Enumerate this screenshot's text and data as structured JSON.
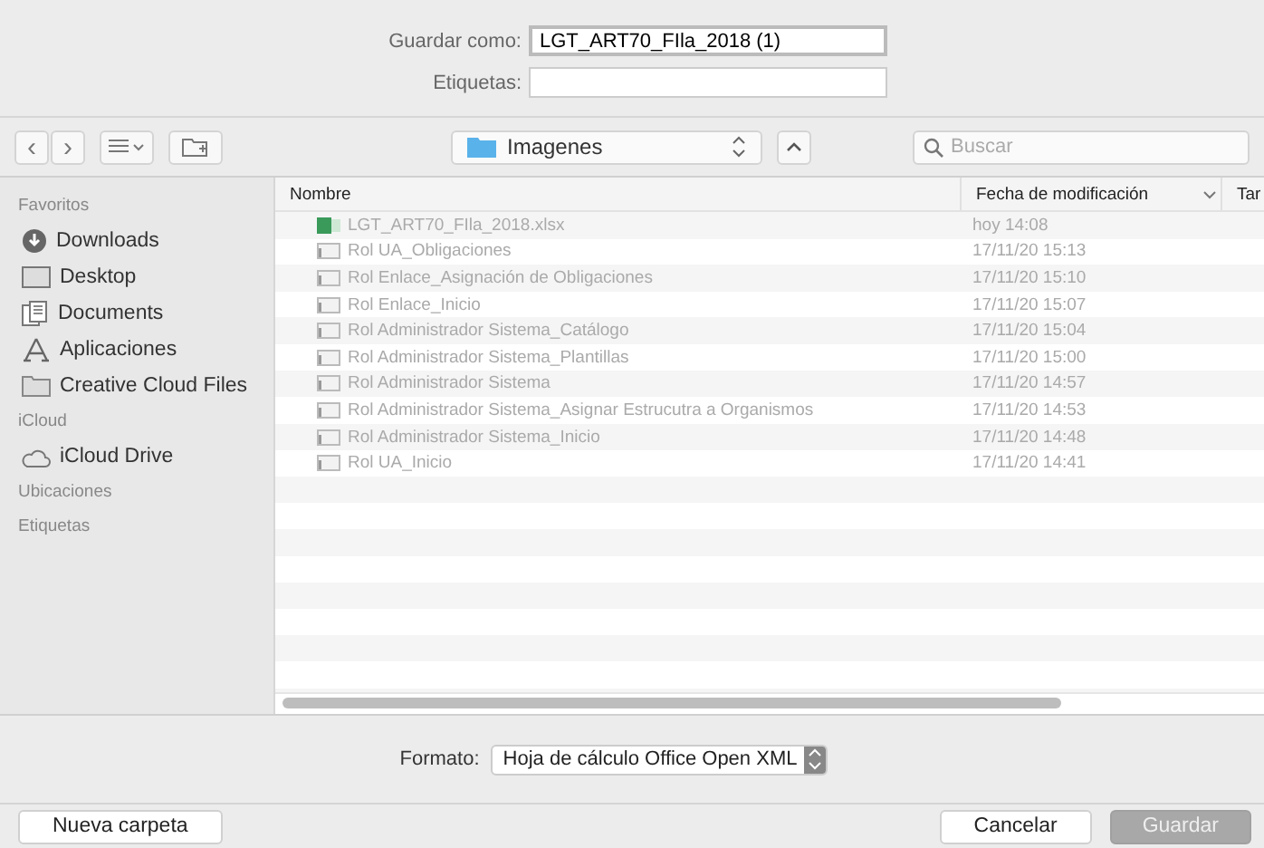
{
  "save_as": {
    "label": "Guardar como:",
    "value": "LGT_ART70_FIla_2018 (1)"
  },
  "tags": {
    "label": "Etiquetas:"
  },
  "toolbar": {
    "back": "‹",
    "forward": "›",
    "location": "Imagenes",
    "search_placeholder": "Buscar"
  },
  "sidebar": {
    "sections": [
      {
        "title": "Favoritos",
        "items": [
          {
            "label": "Downloads",
            "kind": "download"
          },
          {
            "label": "Desktop",
            "kind": "desktop"
          },
          {
            "label": "Documents",
            "kind": "documents"
          },
          {
            "label": "Aplicaciones",
            "kind": "apps"
          },
          {
            "label": "Creative Cloud Files",
            "kind": "folder"
          }
        ]
      },
      {
        "title": "iCloud",
        "items": [
          {
            "label": "iCloud Drive",
            "kind": "cloud"
          }
        ]
      },
      {
        "title": "Ubicaciones"
      },
      {
        "title": "Etiquetas"
      }
    ]
  },
  "table": {
    "columns": [
      "Nombre",
      "Fecha de modificación",
      "Tar"
    ],
    "rows": [
      {
        "name": "LGT_ART70_FIla_2018.xlsx",
        "date": "hoy 14:08",
        "kind": "spreadsheet",
        "disabled": true
      },
      {
        "name": "Rol UA_Obligaciones",
        "date": "17/11/20 15:13",
        "kind": "document",
        "disabled": true
      },
      {
        "name": "Rol Enlace_Asignación de Obligaciones",
        "date": "17/11/20 15:10",
        "kind": "document",
        "disabled": true
      },
      {
        "name": "Rol Enlace_Inicio",
        "date": "17/11/20 15:07",
        "kind": "document",
        "disabled": true
      },
      {
        "name": "Rol Administrador Sistema_Catálogo",
        "date": "17/11/20 15:04",
        "kind": "document",
        "disabled": true
      },
      {
        "name": "Rol Administrador Sistema_Plantillas",
        "date": "17/11/20 15:00",
        "kind": "document",
        "disabled": true
      },
      {
        "name": "Rol Administrador Sistema",
        "date": "17/11/20 14:57",
        "kind": "document",
        "disabled": true
      },
      {
        "name": "Rol Administrador Sistema_Asignar Estrucutra a Organismos",
        "date": "17/11/20 14:53",
        "kind": "document",
        "disabled": true
      },
      {
        "name": "Rol Administrador Sistema_Inicio",
        "date": "17/11/20 14:48",
        "kind": "document",
        "disabled": true
      },
      {
        "name": "Rol UA_Inicio",
        "date": "17/11/20 14:41",
        "kind": "document",
        "disabled": true
      }
    ]
  },
  "format": {
    "label": "Formato:",
    "value": "Hoja de cálculo Office Open XML"
  },
  "buttons": {
    "new_folder": "Nueva carpeta",
    "cancel": "Cancelar",
    "save": "Guardar"
  }
}
